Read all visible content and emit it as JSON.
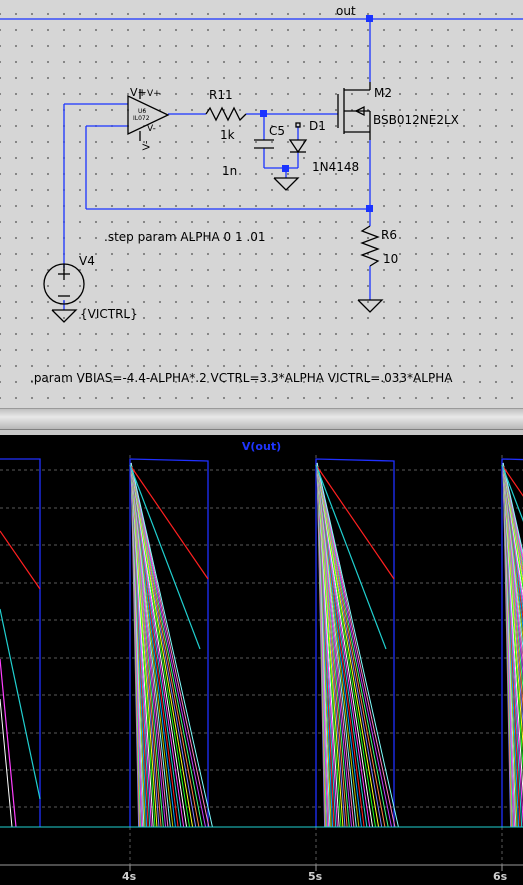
{
  "schematic": {
    "net_out": "out",
    "opamp": {
      "name": "U6",
      "part": "IL072",
      "pin_vp": "V+",
      "pin_vm": "V-"
    },
    "r11": {
      "name": "R11",
      "value": "1k"
    },
    "c5": {
      "name": "C5",
      "value": "1n"
    },
    "d1": {
      "name": "D1",
      "part": "1N4148"
    },
    "m2": {
      "name": "M2",
      "part": "BSB012NE2LX"
    },
    "r6": {
      "name": "R6",
      "value": "10"
    },
    "v4": {
      "name": "V4",
      "value": "{VICTRL}"
    },
    "step_directive": ".step param ALPHA 0 1 .01",
    "param_directive": ".param VBIAS=-4.4-ALPHA*.2 VCTRL=3.3*ALPHA VICTRL=.033*ALPHA"
  },
  "waveform": {
    "trace_name": "V(out)",
    "trace_color": "#1f35ff",
    "x_ticks": [
      "4s",
      "5s",
      "6s"
    ]
  },
  "colors": {
    "wire": "#1a33ff",
    "component": "#000000",
    "plot_bg": "#000000"
  }
}
